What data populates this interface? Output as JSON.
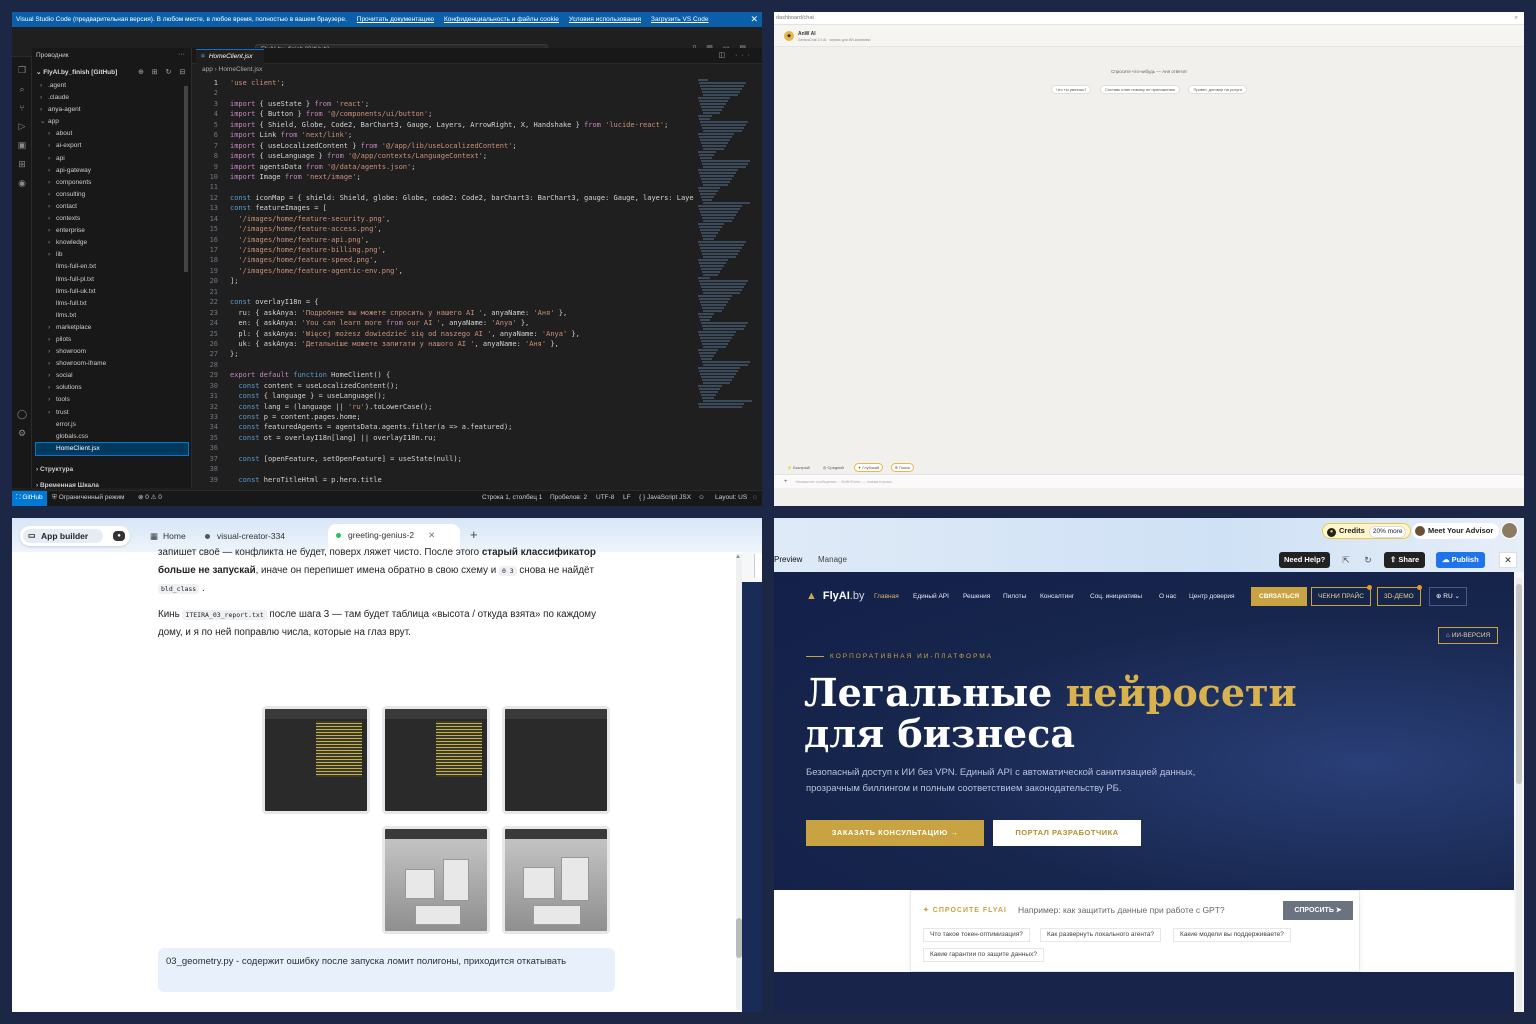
{
  "vscode": {
    "banner": {
      "title": "Visual Studio Code (предварительная версия). В любом месте, в любое время, полностью в вашем браузере.",
      "links": [
        "Прочитать документацию",
        "Конфиденциальность и файлы cookie",
        "Условия использования",
        "Загрузить VS Code"
      ],
      "close": "✕"
    },
    "command_center": "FlyAI.by_finish [GitHub]",
    "explorer": {
      "title": "Проводник",
      "repo": "FlyAI.by_finish [GitHub]",
      "items": [
        {
          "label": ".agent",
          "chev": "›"
        },
        {
          "label": ".claude",
          "chev": "›"
        },
        {
          "label": "anya-agent",
          "chev": "›"
        },
        {
          "label": "app",
          "chev": "⌄"
        },
        {
          "label": "about",
          "chev": "›"
        },
        {
          "label": "ai-export",
          "chev": "›"
        },
        {
          "label": "api",
          "chev": "›"
        },
        {
          "label": "api-gateway",
          "chev": "›"
        },
        {
          "label": "components",
          "chev": "›"
        },
        {
          "label": "consulting",
          "chev": "›"
        },
        {
          "label": "contact",
          "chev": "›"
        },
        {
          "label": "contexts",
          "chev": "›"
        },
        {
          "label": "enterprise",
          "chev": "›"
        },
        {
          "label": "knowledge",
          "chev": "›"
        },
        {
          "label": "lib",
          "chev": "›"
        },
        {
          "label": "llms-full-en.txt",
          "chev": ""
        },
        {
          "label": "llms-full-pl.txt",
          "chev": ""
        },
        {
          "label": "llms-full-uk.txt",
          "chev": ""
        },
        {
          "label": "llms-full.txt",
          "chev": ""
        },
        {
          "label": "llms.txt",
          "chev": ""
        },
        {
          "label": "marketplace",
          "chev": "›"
        },
        {
          "label": "pilots",
          "chev": "›"
        },
        {
          "label": "showroom",
          "chev": "›"
        },
        {
          "label": "showroom-iframe",
          "chev": "›"
        },
        {
          "label": "social",
          "chev": "›"
        },
        {
          "label": "solutions",
          "chev": "›"
        },
        {
          "label": "tools",
          "chev": "›"
        },
        {
          "label": "trust",
          "chev": "›"
        },
        {
          "label": "error.js",
          "chev": ""
        },
        {
          "label": "globals.css",
          "chev": ""
        },
        {
          "label": "HomeClient.jsx",
          "chev": ""
        }
      ],
      "structure": "Структура",
      "timeline": "Временная Шкала"
    },
    "tab": "HomeClient.jsx",
    "breadcrumb": "app  ›  HomeClient.jsx",
    "code_lines": [
      "'use client';",
      "",
      "import { useState } from 'react';",
      "import { Button } from '@/components/ui/button';",
      "import { Shield, Globe, Code2, BarChart3, Gauge, Layers, ArrowRight, X, Handshake } from 'lucide-react';",
      "import Link from 'next/link';",
      "import { useLocalizedContent } from '@/app/lib/useLocalizedContent';",
      "import { useLanguage } from '@/app/contexts/LanguageContext';",
      "import agentsData from '@/data/agents.json';",
      "import Image from 'next/image';",
      "",
      "const iconMap = { shield: Shield, globe: Globe, code2: Code2, barChart3: BarChart3, gauge: Gauge, layers: Laye",
      "const featureImages = [",
      "  '/images/home/feature-security.png',",
      "  '/images/home/feature-access.png',",
      "  '/images/home/feature-api.png',",
      "  '/images/home/feature-billing.png',",
      "  '/images/home/feature-speed.png',",
      "  '/images/home/feature-agentic-env.png',",
      "];",
      "",
      "const overlayI18n = {",
      "  ru: { askAnya: 'Подробнее вы можете спросить у нашего AI ', anyaName: 'Аня' },",
      "  en: { askAnya: 'You can learn more from our AI ', anyaName: 'Anya' },",
      "  pl: { askAnya: 'Więcej możesz dowiedzieć się od naszego AI ', anyaName: 'Anya' },",
      "  uk: { askAnya: 'Детальніше можете запитати у нашого AI ', anyaName: 'Аня' },",
      "};",
      "",
      "export default function HomeClient() {",
      "  const content = useLocalizedContent();",
      "  const { language } = useLanguage();",
      "  const lang = (language || 'ru').toLowerCase();",
      "  const p = content.pages.home;",
      "  const featuredAgents = agentsData.agents.filter(a => a.featured);",
      "  const ot = overlayI18n[lang] || overlayI18n.ru;",
      "",
      "  const [openFeature, setOpenFeature] = useState(null);",
      "",
      "  const heroTitleHtml = p.hero.title"
    ],
    "status": {
      "remote": "GitHub",
      "mode": "Ограниченный режим",
      "problems": "⊗ 0 ⚠ 0",
      "position": "Строка 1, столбец 1",
      "spaces": "Пробелов: 2",
      "encoding": "UTF-8",
      "eol": "LF",
      "language": "{ } JavaScript JSX",
      "layout": "Layout: US"
    }
  },
  "chat": {
    "url": "dashboard/chat",
    "agent_name": "AnW AI",
    "agent_sub": "GeniusChat 2.0 AI · сервис для ИИ-компании",
    "ask": "Спросите что-нибудь — Аня ответит",
    "chips": [
      "Что ты умеешь?",
      "Составь план новому по приложению",
      "Привет, договор на услуги"
    ],
    "models": [
      {
        "label": "⚡ Быстрый",
        "on": false
      },
      {
        "label": "◎ Средний",
        "on": false
      },
      {
        "label": "✦ Глубокий",
        "on": true
      },
      {
        "label": "⊕ Поиск",
        "on": true
      }
    ],
    "input_placeholder": "Напишите сообщение... Shift+Enter — новая строка",
    "plus": "+"
  },
  "appbuilder": {
    "app_builder": "App builder",
    "tabs": [
      {
        "label": "Home"
      },
      {
        "label": "visual-creator-334"
      },
      {
        "label": "greeting-genius-2"
      }
    ],
    "close": "✕",
    "plus": "+",
    "msg1_a": "запишет своё — конфликта не будет, поверх ляжет чисто. После этого ",
    "msg1_b": "старый классификатор больше не запускай",
    "msg1_c": ", иначе он перепишет имена обратно в свою схему и ",
    "msg1_code1": "0 3",
    "msg1_d": " снова не найдёт ",
    "msg1_code2": "bld_class",
    "msg1_e": " .",
    "msg2_a": "Кинь ",
    "msg2_code": "ITEIRA_03_report.txt",
    "msg2_b": " после шага 3 — там будет таблица «высота / откуда взята» по каждому дому, и я по ней поправлю числа, которые на глаз врут.",
    "note": "03_geometry.py - содержит ошибку после запуска ломит полигоны, приходится откатывать"
  },
  "flyai": {
    "credits": "Credits",
    "credits_more": "20% more",
    "advisor": "Meet Your Advisor",
    "preview": "Preview",
    "manage": "Manage",
    "need_help": "Need Help?",
    "share": "Share",
    "publish": "Publish",
    "close": "✕",
    "logo_a": "FlyAI",
    "logo_b": ".by",
    "nav": [
      "Главная",
      "Единый API",
      "Решения",
      "Пилоты",
      "Консалтинг",
      "Соц. инициативы",
      "О нас",
      "Центр доверия"
    ],
    "contact_btn": "СВЯЗАТЬСЯ",
    "price_btn": "ЧЕКНИ ПРАЙС",
    "demo_btn": "3D-ДЕМО",
    "lang": "⊕ RU ⌄",
    "ai_version": "⌂ ИИ-ВЕРСИЯ",
    "eyebrow": "КОРПОРАТИВНАЯ ИИ-ПЛАТФОРМА",
    "h1_a": "Легальные ",
    "h1_b": "нейросети",
    "h1_c": "для бизнеса",
    "lead": "Безопасный доступ к ИИ без VPN. Единый API с автоматической санитизацией данных, прозрачным биллингом и полным соответствием законодательству РБ.",
    "cta1": "ЗАКАЗАТЬ КОНСУЛЬТАЦИЮ  →",
    "cta2": "ПОРТАЛ РАЗРАБОТЧИКА",
    "ask_label": "✦ СПРОСИТЕ FLYAI",
    "ask_placeholder": "Например: как защитить данные при работе с GPT?",
    "ask_btn": "СПРОСИТЬ ➤",
    "suggestions": [
      "Что такое токен-оптимизация?",
      "Как развернуть локального агента?",
      "Какие модели вы поддерживаете?",
      "Какие гарантии по защите данных?"
    ]
  }
}
